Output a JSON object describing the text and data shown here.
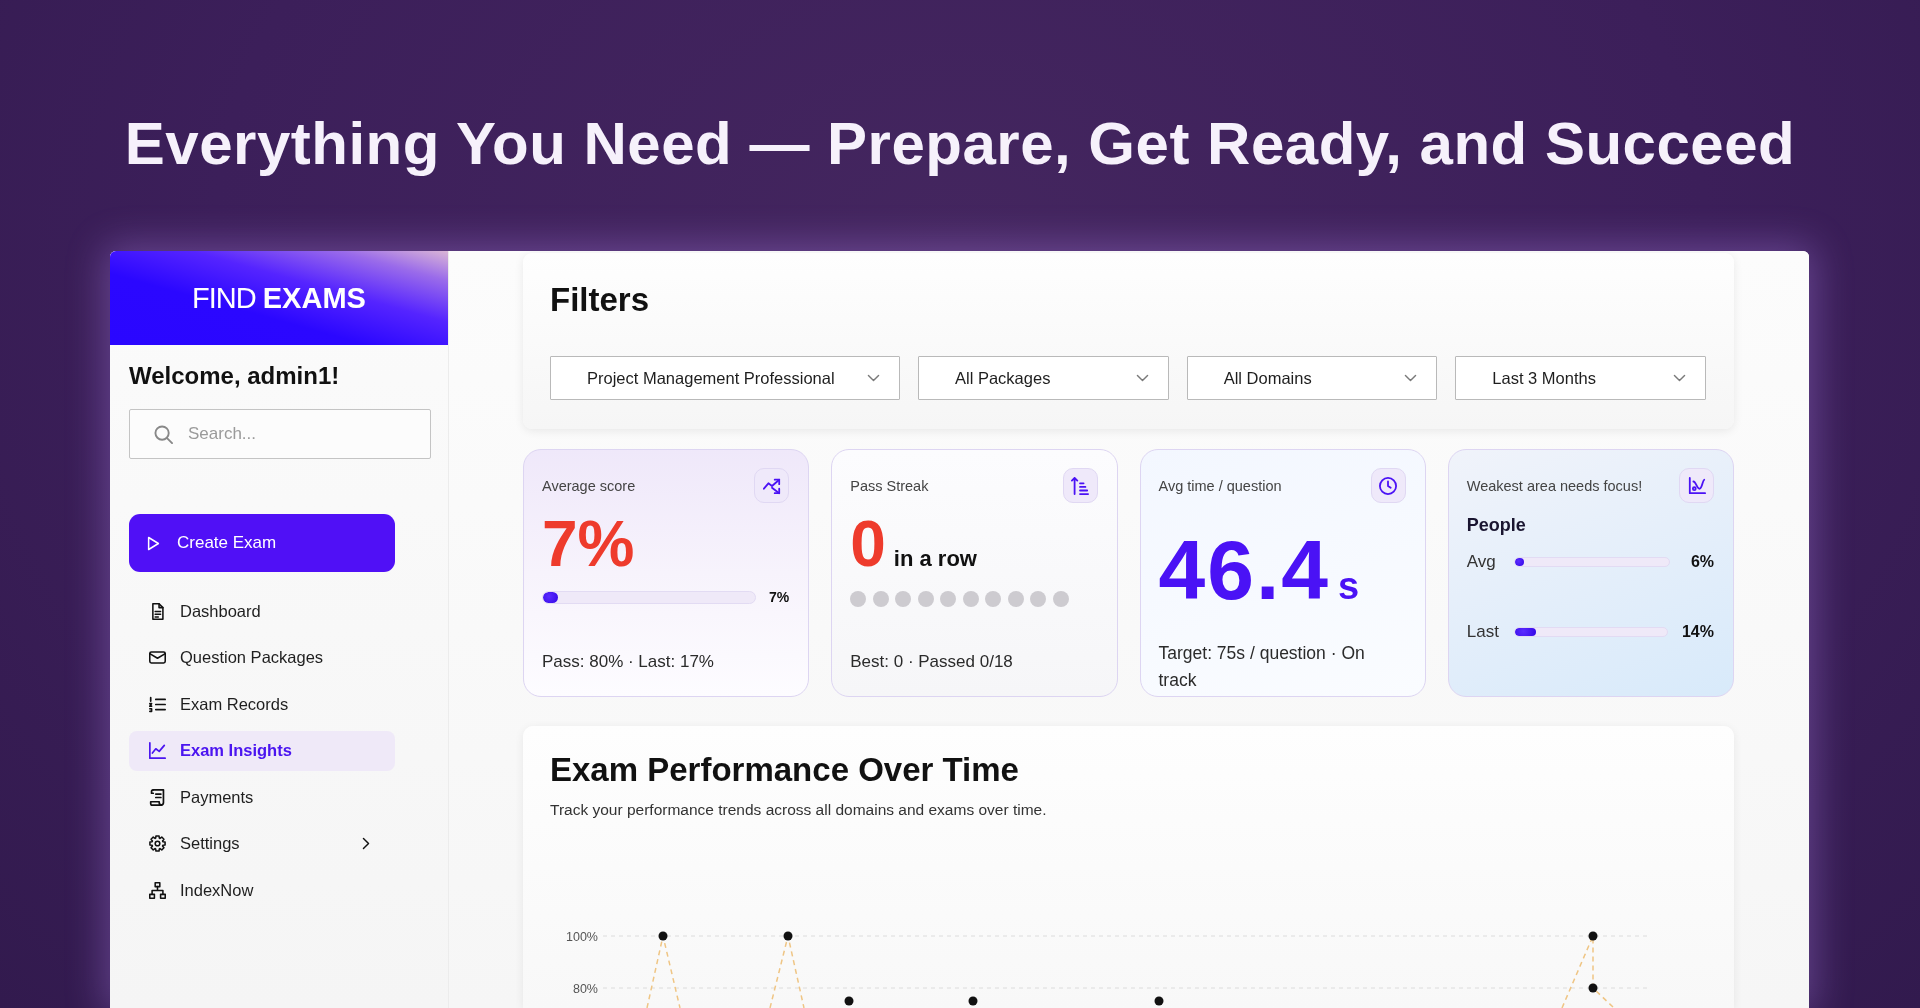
{
  "headline": "Everything You Need — Prepare, Get Ready, and Succeed",
  "sidebar": {
    "logo": "FIND **EXAMS**",
    "welcome": "Welcome, admin1!",
    "search": {
      "placeholder": "Search..."
    },
    "create_button": "Create Exam",
    "items": [
      {
        "label": "Dashboard",
        "selected": false,
        "submenu": false
      },
      {
        "label": "Question Packages",
        "selected": false,
        "submenu": false
      },
      {
        "label": "Exam Records",
        "selected": false,
        "submenu": false
      },
      {
        "label": "Exam Insights",
        "selected": true,
        "submenu": false
      },
      {
        "label": "Payments",
        "selected": false,
        "submenu": false
      },
      {
        "label": "Settings",
        "selected": false,
        "submenu": true
      },
      {
        "label": "IndexNow",
        "selected": false,
        "submenu": false
      }
    ]
  },
  "filters": {
    "title": "Filters",
    "dropdowns": [
      {
        "value": "Project Management Professional"
      },
      {
        "value": "All Packages"
      },
      {
        "value": "All Domains"
      },
      {
        "value": "Last 3 Months"
      }
    ]
  },
  "stat_cards": [
    {
      "kind": "score",
      "label": "Average score",
      "value": "7%",
      "level": 0.07,
      "reading": "7%",
      "footer": "Pass: 80% · Last: 17%"
    },
    {
      "kind": "streak",
      "label": "Pass Streak",
      "value": "0",
      "suffix": "in a row",
      "dots": [
        {
          "passed": false
        },
        {
          "passed": false
        },
        {
          "passed": false
        },
        {
          "passed": false
        },
        {
          "passed": false
        },
        {
          "passed": false
        },
        {
          "passed": false
        },
        {
          "passed": false
        },
        {
          "passed": false
        },
        {
          "passed": false
        }
      ],
      "footer": "Best: 0 · Passed 0/18"
    },
    {
      "kind": "time",
      "label": "Avg time / question",
      "value": "46.4",
      "unit": "s",
      "footer": "Target: 75s / question · On track"
    },
    {
      "kind": "weakest",
      "label": "Weakest area needs focus!",
      "area": "People",
      "bars": [
        {
          "label": "Avg",
          "level": 0.06,
          "reading": "6%"
        },
        {
          "label": "Last",
          "level": 0.14,
          "reading": "14%"
        }
      ]
    }
  ],
  "performance": {
    "title": "Exam Performance Over Time",
    "subtitle": "Track your performance trends across all domains and exams over time.",
    "y_tick_labels": [
      "100%",
      "80%"
    ]
  }
}
